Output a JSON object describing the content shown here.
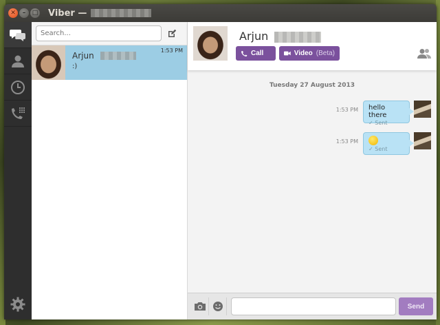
{
  "window": {
    "title": "Viber —",
    "close_glyph": "✕",
    "minimize_glyph": "–",
    "maximize_glyph": "□"
  },
  "rail": {
    "items": [
      {
        "icon": "chat-bubbles-icon",
        "active": true
      },
      {
        "icon": "contacts-icon",
        "active": false
      },
      {
        "icon": "recents-clock-icon",
        "active": false
      },
      {
        "icon": "dialpad-icon",
        "active": false
      }
    ],
    "settings_icon": "gear-icon"
  },
  "sidebar": {
    "search_placeholder": "Search...",
    "compose_icon": "compose-icon",
    "conversations": [
      {
        "name": "Arjun",
        "last_message": ":)",
        "time": "1:53 PM",
        "selected": true
      }
    ]
  },
  "chat": {
    "contact_name": "Arjun",
    "call_label": "Call",
    "video_label": "Video",
    "video_beta": "(Beta)",
    "date_separator": "Tuesday 27 August 2013",
    "messages": [
      {
        "time": "1:53 PM",
        "text": "hello there",
        "status": "Sent"
      },
      {
        "time": "1:53 PM",
        "text": "",
        "emoji": "smiley",
        "status": "Sent"
      }
    ],
    "send_label": "Send"
  },
  "colors": {
    "accent_purple": "#7b519d",
    "selected_row": "#9ccde4",
    "bubble": "#b9e2f5",
    "send_disabled": "#a27cc0",
    "titlebar": "#3c3b37"
  }
}
